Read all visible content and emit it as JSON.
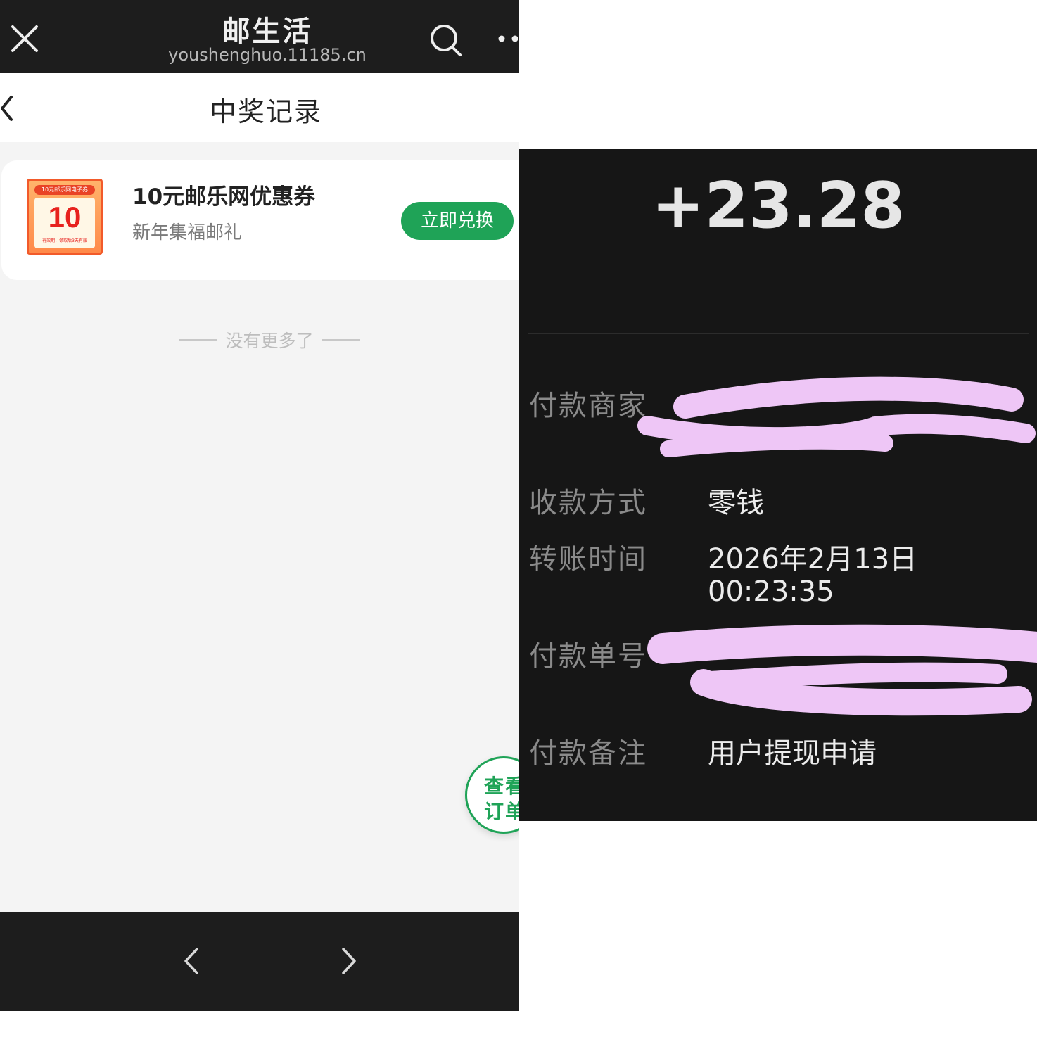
{
  "browser": {
    "title": "邮生活",
    "url": "youshenghuo.11185.cn"
  },
  "header": {
    "title": "中奖记录"
  },
  "prize": {
    "coupon_strip_text": "10元邮乐网电子券",
    "coupon_big": "10",
    "coupon_fine_print": "有效期，领取后3天有效",
    "name": "10元邮乐网优惠券",
    "source": "新年集福邮礼",
    "redeem_label": "立即兑换"
  },
  "list_end_text": "没有更多了",
  "float_button": {
    "line1": "查看",
    "line2": "订单"
  },
  "payment": {
    "amount": "+23.28",
    "rows": {
      "merchant": {
        "label": "付款商家",
        "value": ""
      },
      "method": {
        "label": "收款方式",
        "value": "零钱"
      },
      "time": {
        "label": "转账时间",
        "date": "2026年2月13日",
        "clock": "00:23:35"
      },
      "order_no": {
        "label": "付款单号",
        "value": ""
      },
      "remark": {
        "label": "付款备注",
        "value": "用户提现申请"
      }
    }
  },
  "colors": {
    "brand_green": "#1fa357",
    "dark_bar": "#1d1d1d",
    "redaction": "#eec6f6"
  }
}
